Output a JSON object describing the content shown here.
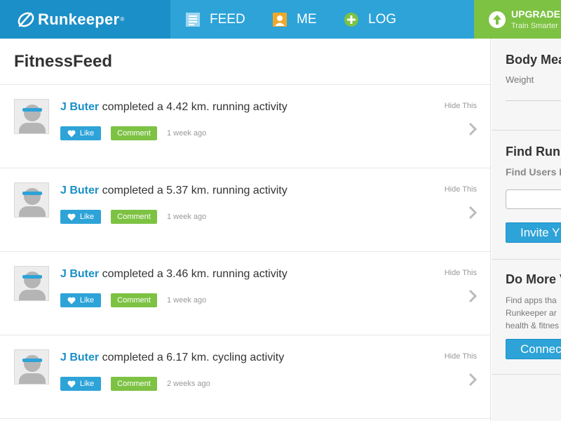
{
  "app": {
    "logo_text": "Runkeeper",
    "logo_mark": "®"
  },
  "nav": {
    "feed_label": "FEED",
    "me_label": "ME",
    "log_label": "LOG"
  },
  "upgrade": {
    "title": "UPGRADE",
    "subtitle": "Train Smarter"
  },
  "feed": {
    "title": "FitnessFeed",
    "items": [
      {
        "user": "J Buter",
        "text": " completed a 4.42 km. running activity",
        "like": "Like",
        "comment": "Comment",
        "time": "1 week ago",
        "hide": "Hide This"
      },
      {
        "user": "J Buter",
        "text": " completed a 5.37 km. running activity",
        "like": "Like",
        "comment": "Comment",
        "time": "1 week ago",
        "hide": "Hide This"
      },
      {
        "user": "J Buter",
        "text": " completed a 3.46 km. running activity",
        "like": "Like",
        "comment": "Comment",
        "time": "1 week ago",
        "hide": "Hide This"
      },
      {
        "user": "J Buter",
        "text": " completed a 6.17 km. cycling activity",
        "like": "Like",
        "comment": "Comment",
        "time": "2 weeks ago",
        "hide": "Hide This"
      }
    ]
  },
  "sidebar": {
    "body": {
      "title": "Body Mea",
      "label": "Weight"
    },
    "find": {
      "title": "Find Run",
      "label": "Find Users I",
      "button": "Invite Y"
    },
    "more": {
      "title": "Do More V",
      "lines": [
        "Find apps tha",
        "Runkeeper ar",
        "health & fitnes"
      ],
      "button": "Connec"
    }
  },
  "colors": {
    "brand_blue": "#2da3d8",
    "brand_dark_blue": "#1b8fc8",
    "accent_green": "#7dc243",
    "icon_orange": "#f0a82a"
  },
  "icons": {
    "feed": "document-lines-icon",
    "me": "person-icon",
    "log": "plus-circle-icon",
    "upgrade": "arrow-up-circle-icon",
    "like": "heart-icon",
    "chevron": "chevron-right-icon"
  }
}
